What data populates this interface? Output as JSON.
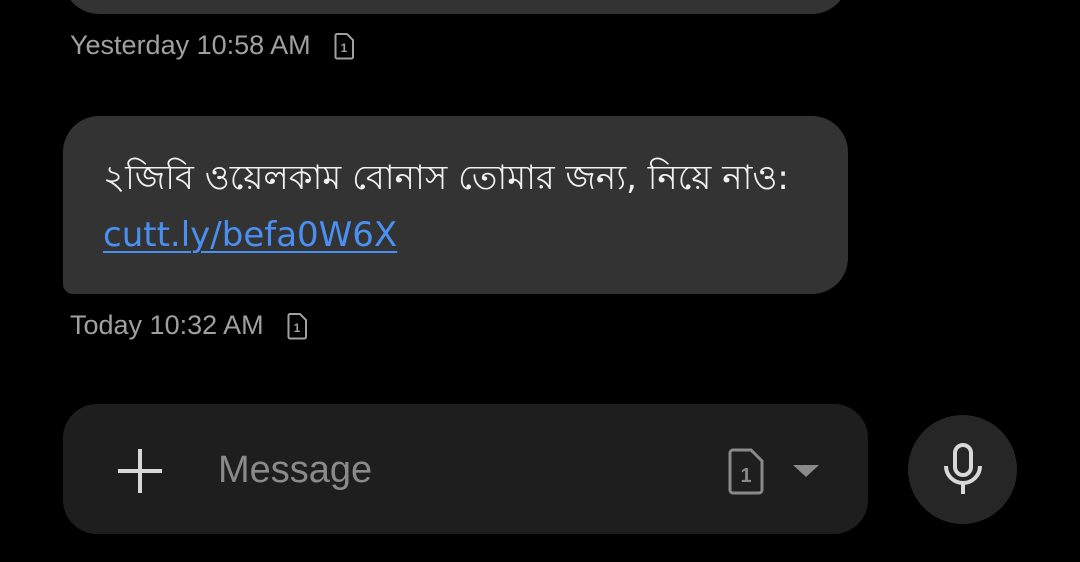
{
  "messages": [
    {
      "text_prefix": "",
      "link": "",
      "timestamp": "Yesterday 10:58 AM",
      "sim_icon": "sim-1-icon"
    },
    {
      "text_prefix": "২জিবি ওয়েলকাম বোনাস তোমার জন্য, নিয়ে নাও: ",
      "link": "cutt.ly/befa0W6X",
      "timestamp": "Today 10:32 AM",
      "sim_icon": "sim-1-icon"
    }
  ],
  "composer": {
    "placeholder": "Message",
    "add_icon": "plus-icon",
    "sim_selector_icon": "sim-1-icon",
    "dropdown_icon": "caret-down-icon",
    "mic_icon": "microphone-icon"
  },
  "colors": {
    "background": "#000000",
    "bubble": "#333333",
    "link": "#4a90f2",
    "meta_text": "#a0a0a0",
    "composer_bg": "#1e1e1e",
    "mic_bg": "#262626"
  }
}
